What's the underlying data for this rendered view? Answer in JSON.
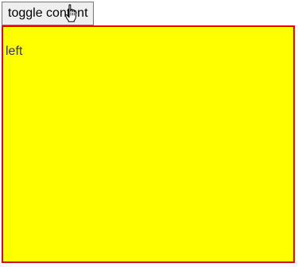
{
  "toolbar": {
    "toggle_label": "toggle content"
  },
  "panel": {
    "label": "left",
    "background_color": "#ffff00",
    "border_color": "#e8001c"
  },
  "cursor": {
    "icon": "hand-pointer-icon"
  }
}
